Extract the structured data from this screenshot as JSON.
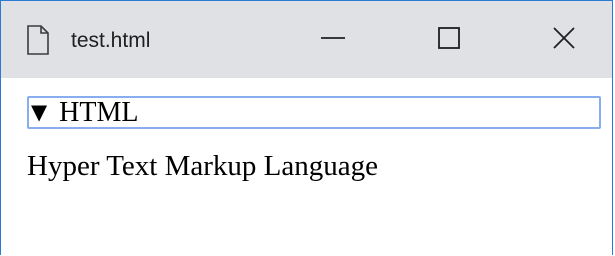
{
  "window": {
    "tab_title": "test.html",
    "accent_color": "#2b7bd6",
    "titlebar_color": "#dfe1e5"
  },
  "details": {
    "expanded_marker": "▼",
    "summary": "HTML",
    "body": "Hyper Text Markup Language",
    "focus_color": "#89aef0"
  },
  "icons": {
    "file": "file-icon",
    "minimize": "minimize-icon",
    "maximize": "maximize-icon",
    "close": "close-icon"
  }
}
